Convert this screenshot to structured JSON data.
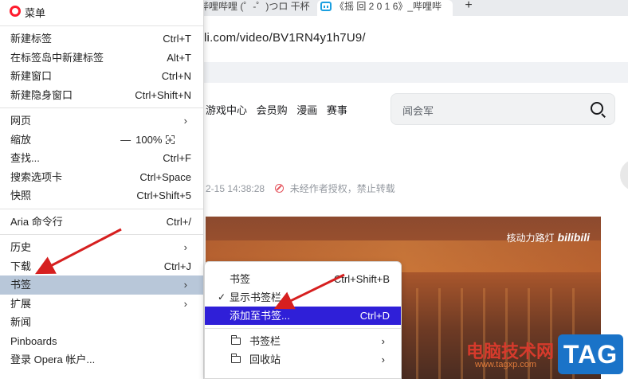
{
  "browser": {
    "tabs": [
      {
        "title": "哔哩哔哩 (゜-゜)つロ 干杯"
      },
      {
        "title": "《摇 回 2 0 1 6》_哔哩哔"
      }
    ],
    "new_tab_glyph": "+",
    "address": "li.com/video/BV1RN4y1h7U9/"
  },
  "page": {
    "nav": [
      "游戏中心",
      "会员购",
      "漫画",
      "赛事"
    ],
    "search_placeholder": "闻会军",
    "meta_time": "2-15 14:38:28",
    "meta_notice": "未经作者授权，禁止转载",
    "video_label": "核动力路灯",
    "video_logo": "bilibili",
    "watermark_text": "电脑技术网",
    "watermark_url": "www.tagxp.com",
    "tag_badge": "TAG"
  },
  "menu": {
    "title": "菜单",
    "groups": [
      [
        {
          "label": "新建标签",
          "shortcut": "Ctrl+T"
        },
        {
          "label": "在标签岛中新建标签",
          "shortcut": "Alt+T"
        },
        {
          "label": "新建窗口",
          "shortcut": "Ctrl+N"
        },
        {
          "label": "新建隐身窗口",
          "shortcut": "Ctrl+Shift+N"
        }
      ],
      [
        {
          "label": "网页",
          "submenu": true
        },
        {
          "label": "缩放",
          "zoom": "100%",
          "minus": "—",
          "plus": "+"
        },
        {
          "label": "查找...",
          "shortcut": "Ctrl+F"
        },
        {
          "label": "搜索选项卡",
          "shortcut": "Ctrl+Space"
        },
        {
          "label": "快照",
          "shortcut": "Ctrl+Shift+5"
        }
      ],
      [
        {
          "label": "Aria 命令行",
          "shortcut": "Ctrl+/"
        }
      ],
      [
        {
          "label": "历史",
          "submenu": true
        },
        {
          "label": "下载",
          "shortcut": "Ctrl+J"
        },
        {
          "label": "书签",
          "submenu": true,
          "active": true
        },
        {
          "label": "扩展",
          "submenu": true
        },
        {
          "label": "新闻"
        },
        {
          "label": "Pinboards"
        },
        {
          "label": "登录 Opera 帐户..."
        }
      ]
    ]
  },
  "bookmarks_submenu": {
    "items": [
      {
        "label": "书签",
        "shortcut": "Ctrl+Shift+B"
      },
      {
        "label": "显示书签栏",
        "checked": true
      },
      {
        "label": "添加至书签...",
        "shortcut": "Ctrl+D",
        "highlighted": true
      },
      {
        "label": "书签栏",
        "folder": true
      },
      {
        "label": "回收站",
        "folder": true
      }
    ]
  },
  "colors": {
    "menu_active": "#b8c7d9",
    "submenu_highlight": "#2f1fd8",
    "arrow": "#d61f1f",
    "opera_red": "#ff1b2d"
  }
}
